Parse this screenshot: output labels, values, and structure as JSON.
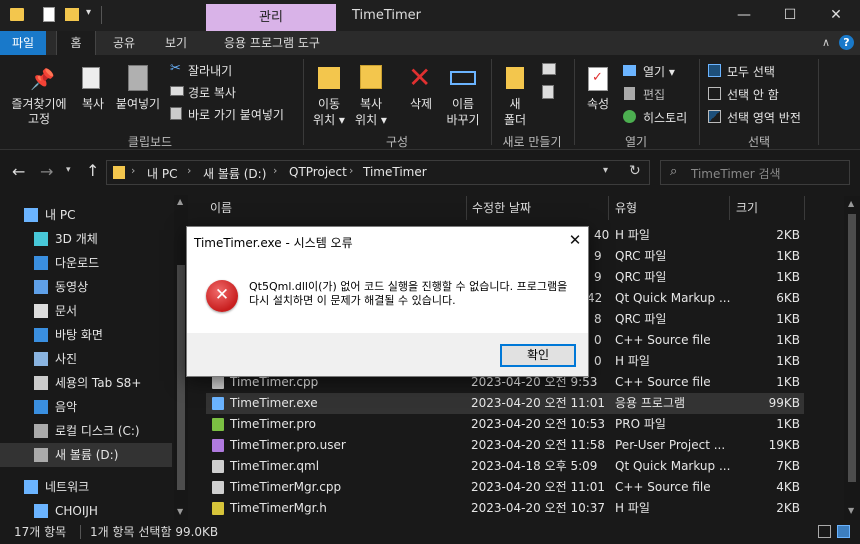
{
  "window": {
    "context_tab": "관리",
    "title": "TimeTimer",
    "min_icon": "minimize-icon",
    "max_icon": "maximize-icon",
    "close_icon": "close-icon"
  },
  "ribbon_tabs": {
    "file": "파일",
    "home": "홈",
    "share": "공유",
    "view": "보기",
    "app_tools": "응용 프로그램 도구"
  },
  "clipboard": {
    "pin": "즐겨찾기에 고정",
    "copy": "복사",
    "paste": "붙여넣기",
    "cut": "잘라내기",
    "copy_path": "경로 복사",
    "paste_shortcut": "바로 가기 붙여넣기",
    "group": "클립보드"
  },
  "organize": {
    "move": "이동",
    "move2": "위치 ▾",
    "copyto": "복사",
    "copyto2": "위치 ▾",
    "delete": "삭제",
    "rename": "이름",
    "rename2": "바꾸기",
    "group": "구성"
  },
  "new": {
    "folder": "새",
    "folder2": "폴더",
    "group": "새로 만들기"
  },
  "open": {
    "properties": "속성",
    "open": "열기 ▾",
    "edit": "편집",
    "history": "히스토리",
    "group": "열기"
  },
  "select": {
    "all": "모두 선택",
    "none": "선택 안 함",
    "invert": "선택 영역 반전",
    "group": "선택"
  },
  "address": {
    "crumbs": [
      "내 PC",
      "새 볼륨 (D:)",
      "QTProject",
      "TimeTimer"
    ],
    "search_placeholder": "TimeTimer 검색"
  },
  "nav": [
    {
      "label": "내 PC",
      "icon": "pc-icon"
    },
    {
      "label": "3D 개체",
      "icon": "3d-objects-icon"
    },
    {
      "label": "다운로드",
      "icon": "download-icon"
    },
    {
      "label": "동영상",
      "icon": "video-icon"
    },
    {
      "label": "문서",
      "icon": "document-icon"
    },
    {
      "label": "바탕 화면",
      "icon": "desktop-icon"
    },
    {
      "label": "사진",
      "icon": "picture-icon"
    },
    {
      "label": "세용의 Tab S8+",
      "icon": "tablet-icon"
    },
    {
      "label": "음악",
      "icon": "music-icon"
    },
    {
      "label": "로컬 디스크 (C:)",
      "icon": "drive-icon"
    },
    {
      "label": "새 볼륨 (D:)",
      "icon": "drive-icon"
    },
    {
      "label": "네트워크",
      "icon": "network-icon"
    },
    {
      "label": "CHOIJH",
      "icon": "computer-icon"
    }
  ],
  "columns": {
    "name": "이름",
    "modified": "수정한 날짜",
    "type": "유형",
    "size": "크기"
  },
  "files": [
    {
      "name": "",
      "date": "",
      "type": "H 파일",
      "size": "2KB",
      "icon": "h-file-icon",
      "kind": "h"
    },
    {
      "name": "",
      "date": "",
      "type": "QRC 파일",
      "size": "1KB",
      "icon": "qrc-file-icon",
      "kind": "qrc"
    },
    {
      "name": "",
      "date": "",
      "type": "QRC 파일",
      "size": "1KB",
      "icon": "qrc-file-icon",
      "kind": "qrc"
    },
    {
      "name": "",
      "date": "",
      "type": "Qt Quick Markup ...",
      "size": "6KB",
      "icon": "qml-file-icon",
      "kind": "qml"
    },
    {
      "name": "",
      "date": "",
      "type": "QRC 파일",
      "size": "1KB",
      "icon": "qrc-file-icon",
      "kind": "qrc"
    },
    {
      "name": "",
      "date": "",
      "type": "C++ Source file",
      "size": "1KB",
      "icon": "cpp-file-icon",
      "kind": "cpp"
    },
    {
      "name": "",
      "date": "",
      "type": "H 파일",
      "size": "1KB",
      "icon": "h-file-icon",
      "kind": "h"
    },
    {
      "name": "TimeTimer.cpp",
      "date": "2023-04-20 오전 9:53",
      "type": "C++ Source file",
      "size": "1KB",
      "icon": "cpp-file-icon",
      "kind": "cpp"
    },
    {
      "name": "TimeTimer.exe",
      "date": "2023-04-20 오전 11:01",
      "type": "응용 프로그램",
      "size": "99KB",
      "icon": "exe-file-icon",
      "kind": "exe",
      "selected": true
    },
    {
      "name": "TimeTimer.pro",
      "date": "2023-04-20 오전 10:53",
      "type": "PRO 파일",
      "size": "1KB",
      "icon": "pro-file-icon",
      "kind": "pro"
    },
    {
      "name": "TimeTimer.pro.user",
      "date": "2023-04-20 오전 11:58",
      "type": "Per-User Project ...",
      "size": "19KB",
      "icon": "user-file-icon",
      "kind": "user"
    },
    {
      "name": "TimeTimer.qml",
      "date": "2023-04-18 오후 5:09",
      "type": "Qt Quick Markup ...",
      "size": "7KB",
      "icon": "qml-file-icon",
      "kind": "qml"
    },
    {
      "name": "TimeTimerMgr.cpp",
      "date": "2023-04-20 오전 11:01",
      "type": "C++ Source file",
      "size": "4KB",
      "icon": "cpp-file-icon",
      "kind": "cpp"
    },
    {
      "name": "TimeTimerMgr.h",
      "date": "2023-04-20 오전 10:37",
      "type": "H 파일",
      "size": "2KB",
      "icon": "h-file-icon",
      "kind": "h"
    }
  ],
  "partial_dates": [
    "40",
    "9",
    "9",
    "42",
    "8",
    "0",
    "0"
  ],
  "status": {
    "count": "17개 항목",
    "selected": "1개 항목 선택함 99.0KB"
  },
  "dialog": {
    "title": "TimeTimer.exe - 시스템 오류",
    "message": "Qt5Qml.dll이(가) 없어 코드 실행을 진행할 수 없습니다. 프로그램을 다시 설치하면 이 문제가 해결될 수 있습니다.",
    "ok": "확인",
    "icon": "error-icon"
  },
  "colors": {
    "accent": "#1979ca",
    "context_tab": "#d9b3e8",
    "selected_row": "#333333",
    "error": "#c81e1e"
  }
}
